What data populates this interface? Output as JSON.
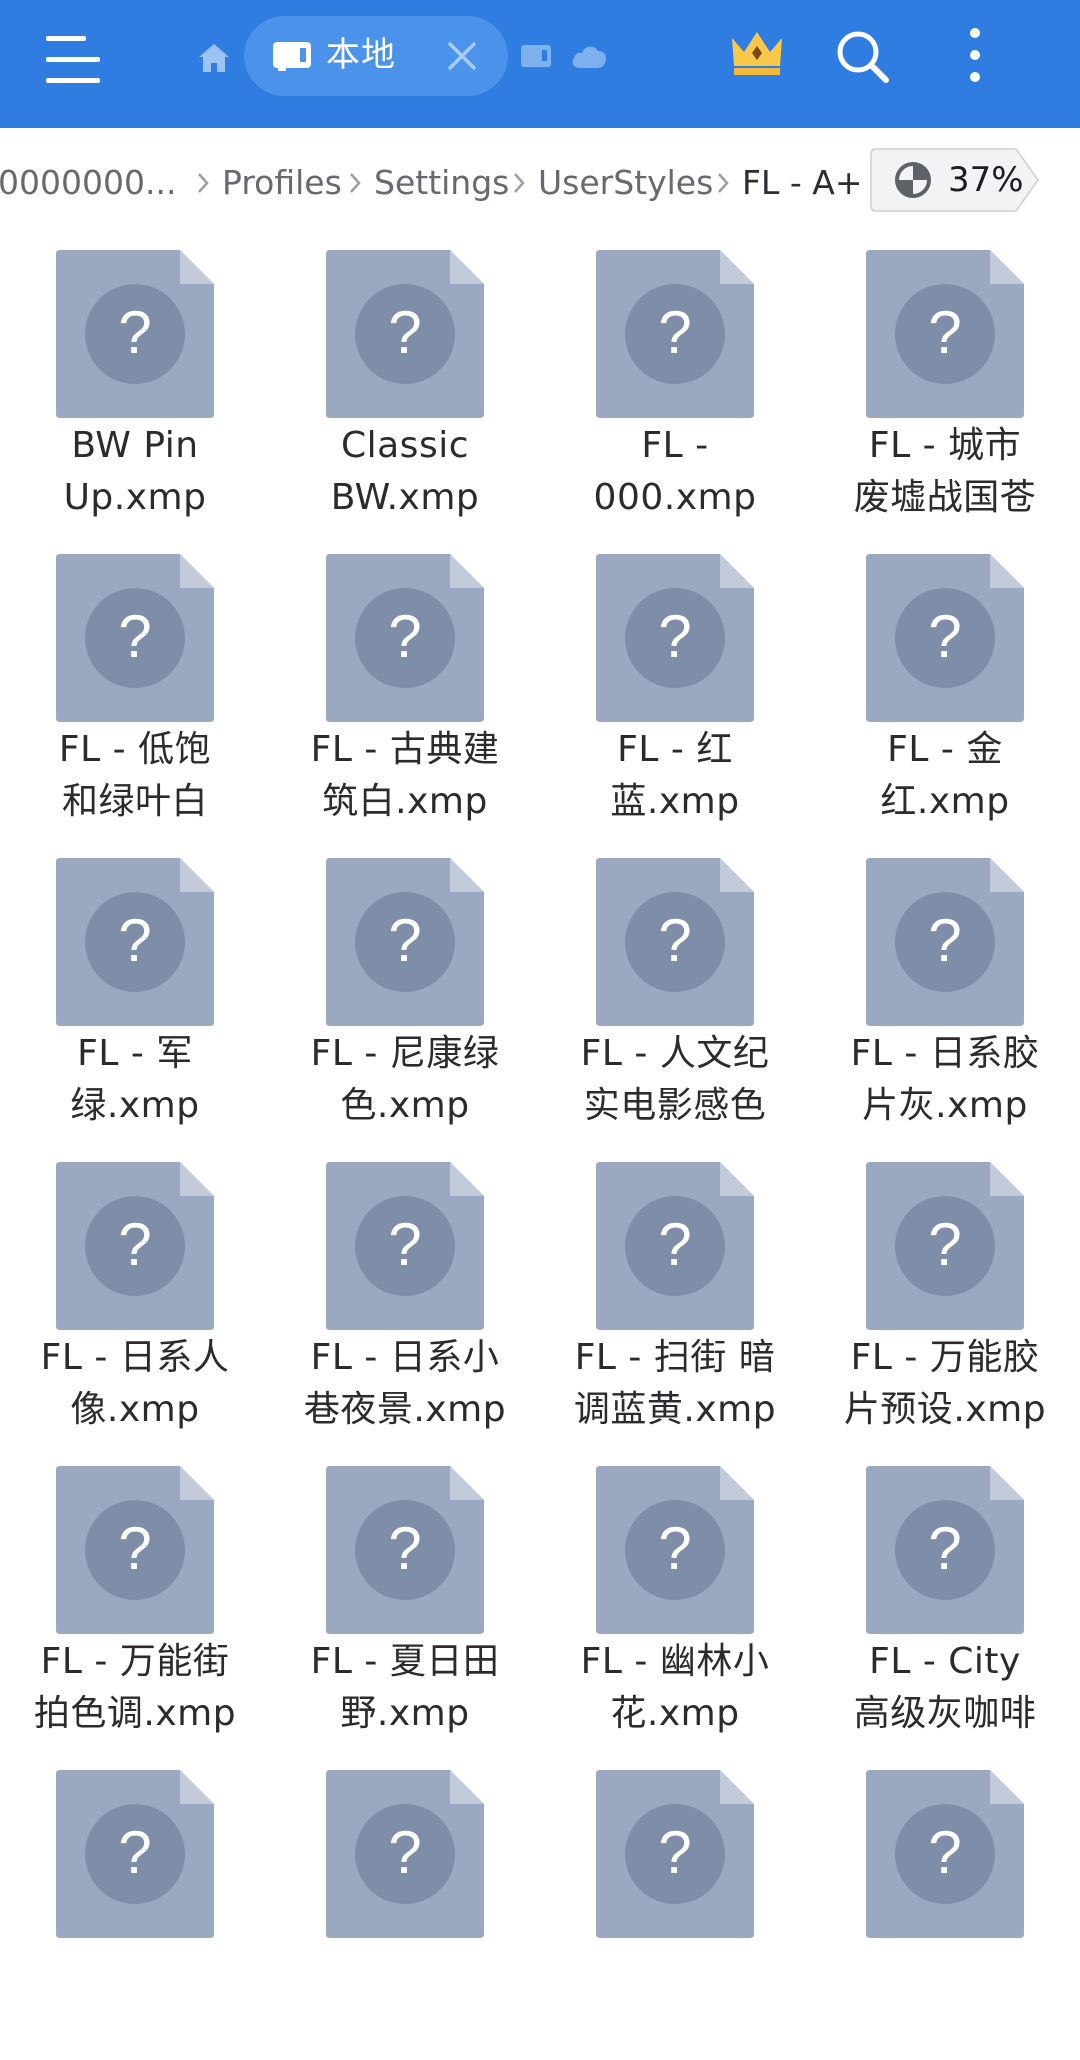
{
  "header": {
    "tab_label": "本地",
    "icons": [
      "menu-icon",
      "home-icon",
      "storage-icon",
      "close-icon",
      "sd-card-icon",
      "cloud-icon",
      "crown-icon",
      "search-icon",
      "more-icon"
    ],
    "accent_color": "#2f7de1"
  },
  "breadcrumb": {
    "items": [
      "0000000...",
      "Profiles",
      "Settings",
      "UserStyles",
      "FL - A+"
    ],
    "storage_usage": "37%"
  },
  "files": [
    {
      "line1": "BW Pin",
      "line2": "Up.xmp"
    },
    {
      "line1": "Classic",
      "line2": "BW.xmp"
    },
    {
      "line1": "FL -",
      "line2": "000.xmp"
    },
    {
      "line1": "FL - 城市",
      "line2": "废墟战国苍"
    },
    {
      "line1": "FL - 低饱",
      "line2": "和绿叶白"
    },
    {
      "line1": "FL - 古典建",
      "line2": "筑白.xmp"
    },
    {
      "line1": "FL - 红",
      "line2": "蓝.xmp"
    },
    {
      "line1": "FL - 金",
      "line2": "红.xmp"
    },
    {
      "line1": "FL - 军",
      "line2": "绿.xmp"
    },
    {
      "line1": "FL - 尼康绿",
      "line2": "色.xmp"
    },
    {
      "line1": "FL - 人文纪",
      "line2": "实电影感色"
    },
    {
      "line1": "FL - 日系胶",
      "line2": "片灰.xmp"
    },
    {
      "line1": "FL - 日系人",
      "line2": "像.xmp"
    },
    {
      "line1": "FL - 日系小",
      "line2": "巷夜景.xmp"
    },
    {
      "line1": "FL - 扫街 暗",
      "line2": "调蓝黄.xmp"
    },
    {
      "line1": "FL - 万能胶",
      "line2": "片预设.xmp"
    },
    {
      "line1": "FL - 万能街",
      "line2": "拍色调.xmp"
    },
    {
      "line1": "FL - 夏日田",
      "line2": "野.xmp"
    },
    {
      "line1": "FL - 幽林小",
      "line2": "花.xmp"
    },
    {
      "line1": "FL - City",
      "line2": "高级灰咖啡"
    },
    {
      "line1": "",
      "line2": ""
    },
    {
      "line1": "",
      "line2": ""
    },
    {
      "line1": "",
      "line2": ""
    },
    {
      "line1": "",
      "line2": ""
    }
  ],
  "file_icon": {
    "name": "unknown-file-icon",
    "body_color": "#9aa8c1",
    "circle_color": "#7f8ea8"
  }
}
